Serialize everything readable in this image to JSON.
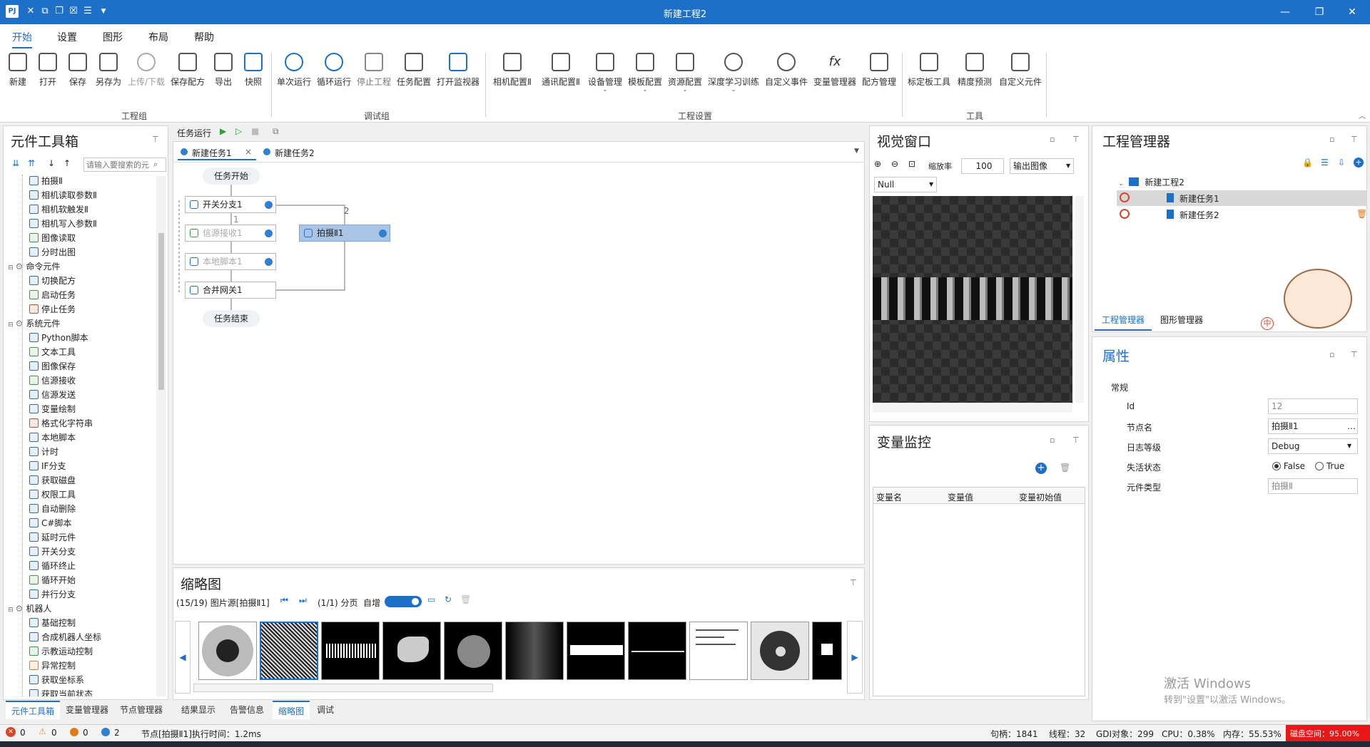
{
  "title": "新建工程2",
  "menus": [
    "开始",
    "设置",
    "图形",
    "布局",
    "帮助"
  ],
  "ribbon": {
    "g1": [
      "新建",
      "打开",
      "保存",
      "另存为",
      "上传/下载",
      "保存配方",
      "导出",
      "快照"
    ],
    "g1_label": "工程组",
    "g2": [
      "单次运行",
      "循环运行",
      "停止工程",
      "任务配置",
      "打开监视器"
    ],
    "g2_label": "调试组",
    "g3": [
      "相机配置Ⅱ",
      "通讯配置Ⅱ",
      "设备管理",
      "模板配置",
      "资源配置",
      "深度学习训练",
      "自定义事件",
      "变量管理器",
      "配方管理"
    ],
    "g3_label": "工程设置",
    "g4": [
      "标定板工具",
      "精度预测",
      "自定义元件"
    ],
    "g4_label": "工具"
  },
  "toolbox": {
    "title": "元件工具箱",
    "search_placeholder": "请输入要搜索的元",
    "items": [
      {
        "t": "item",
        "label": "拍摄Ⅱ",
        "c": "b"
      },
      {
        "t": "item",
        "label": "相机读取参数Ⅱ",
        "c": "b"
      },
      {
        "t": "item",
        "label": "相机软触发Ⅱ",
        "c": "b"
      },
      {
        "t": "item",
        "label": "相机写入参数Ⅱ",
        "c": "b"
      },
      {
        "t": "item",
        "label": "图像读取",
        "c": "g"
      },
      {
        "t": "item",
        "label": "分时出图",
        "c": "b"
      },
      {
        "t": "group",
        "label": "命令元件"
      },
      {
        "t": "item",
        "label": "切换配方",
        "c": "b"
      },
      {
        "t": "item",
        "label": "启动任务",
        "c": "g"
      },
      {
        "t": "item",
        "label": "停止任务",
        "c": "r"
      },
      {
        "t": "group",
        "label": "系统元件"
      },
      {
        "t": "item",
        "label": "Python脚本",
        "c": "b"
      },
      {
        "t": "item",
        "label": "文本工具",
        "c": "g"
      },
      {
        "t": "item",
        "label": "图像保存",
        "c": "b"
      },
      {
        "t": "item",
        "label": "信源接收",
        "c": "g"
      },
      {
        "t": "item",
        "label": "信源发送",
        "c": "b"
      },
      {
        "t": "item",
        "label": "变量绘制",
        "c": "b"
      },
      {
        "t": "item",
        "label": "格式化字符串",
        "c": "r"
      },
      {
        "t": "item",
        "label": "本地脚本",
        "c": "b"
      },
      {
        "t": "item",
        "label": "计时",
        "c": "b"
      },
      {
        "t": "item",
        "label": "IF分支",
        "c": "b"
      },
      {
        "t": "item",
        "label": "获取磁盘",
        "c": "b"
      },
      {
        "t": "item",
        "label": "权限工具",
        "c": "b"
      },
      {
        "t": "item",
        "label": "自动删除",
        "c": "b"
      },
      {
        "t": "item",
        "label": "C#脚本",
        "c": "b"
      },
      {
        "t": "item",
        "label": "延时元件",
        "c": "b"
      },
      {
        "t": "item",
        "label": "开关分支",
        "c": "b"
      },
      {
        "t": "item",
        "label": "循环终止",
        "c": "b"
      },
      {
        "t": "item",
        "label": "循环开始",
        "c": "g"
      },
      {
        "t": "item",
        "label": "并行分支",
        "c": "b"
      },
      {
        "t": "group",
        "label": "机器人"
      },
      {
        "t": "item",
        "label": "基础控制",
        "c": "b"
      },
      {
        "t": "item",
        "label": "合成机器人坐标",
        "c": "b"
      },
      {
        "t": "item",
        "label": "示教运动控制",
        "c": "g"
      },
      {
        "t": "item",
        "label": "异常控制",
        "c": "o"
      },
      {
        "t": "item",
        "label": "获取坐标系",
        "c": "b"
      },
      {
        "t": "item",
        "label": "获取当前状态",
        "c": "b"
      }
    ],
    "tabs": [
      "元件工具箱",
      "变量管理器",
      "节点管理器"
    ]
  },
  "task": {
    "run_label": "任务运行",
    "tabs": [
      "新建任务1",
      "新建任务2"
    ],
    "start": "任务开始",
    "end": "任务结束",
    "nodes": [
      "开关分支1",
      "信源接收1",
      "本地脚本1",
      "合并网关1",
      "拍摄Ⅱ1"
    ],
    "branch1": "1",
    "branch2": "2"
  },
  "thumbs": {
    "title": "缩略图",
    "source": "(15/19) 图片源[拍摄Ⅱ1]",
    "page": "(1/1) 分页",
    "auto": "自增",
    "tabs": [
      "结果显示",
      "告警信息",
      "缩略图",
      "调试"
    ]
  },
  "vision": {
    "title": "视觉窗口",
    "zoom_label": "缩放率",
    "zoom": "100",
    "output": "输出图像",
    "null": "Null"
  },
  "varmon": {
    "title": "变量监控",
    "cols": [
      "变量名",
      "变量值",
      "变量初始值"
    ]
  },
  "proj": {
    "title": "工程管理器",
    "root": "新建工程2",
    "tasks": [
      "新建任务1",
      "新建任务2"
    ],
    "tabs": [
      "工程管理器",
      "图形管理器"
    ]
  },
  "props": {
    "title": "属性",
    "section": "常规",
    "labels": [
      "Id",
      "节点名",
      "日志等级",
      "失活状态",
      "元件类型"
    ],
    "id": "12",
    "name": "拍摄Ⅱ1",
    "log": "Debug",
    "false": "False",
    "true": "True",
    "type": "拍摄Ⅱ"
  },
  "watermark": {
    "l1": "激活 Windows",
    "l2": "转到\"设置\"以激活 Windows。"
  },
  "ime": "中",
  "status": {
    "err": "0",
    "warn": "0",
    "o": "0",
    "info": "2",
    "msg": "节点[拍摄Ⅱ1]执行时间：1.2ms",
    "handles": "句柄：1841",
    "threads": "线程：32",
    "gdi": "GDI对象：299",
    "cpu": "CPU：0.38%",
    "mem": "内存：55.53%",
    "alert": "磁盘空间：95.00%"
  }
}
